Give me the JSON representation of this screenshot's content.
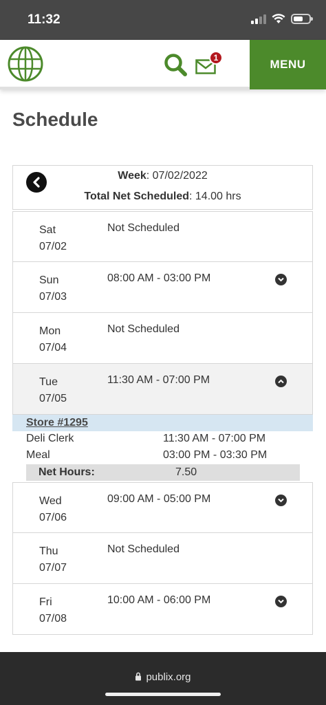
{
  "status_bar": {
    "time": "11:32"
  },
  "header": {
    "mail_badge": "1",
    "menu_label": "MENU"
  },
  "page": {
    "title": "Schedule"
  },
  "week": {
    "week_label": "Week",
    "week_value": ": 07/02/2022",
    "total_label": "Total Net Scheduled",
    "total_value": ": 14.00 hrs"
  },
  "days": [
    {
      "dow": "Sat",
      "date": "07/02",
      "shift": "Not Scheduled"
    },
    {
      "dow": "Sun",
      "date": "07/03",
      "shift": "08:00 AM - 03:00 PM"
    },
    {
      "dow": "Mon",
      "date": "07/04",
      "shift": "Not Scheduled"
    },
    {
      "dow": "Tue",
      "date": "07/05",
      "shift": "11:30 AM - 07:00 PM"
    },
    {
      "dow": "Wed",
      "date": "07/06",
      "shift": "09:00 AM - 05:00 PM"
    },
    {
      "dow": "Thu",
      "date": "07/07",
      "shift": "Not Scheduled"
    },
    {
      "dow": "Fri",
      "date": "07/08",
      "shift": "10:00 AM - 06:00 PM"
    }
  ],
  "detail": {
    "store": "Store #1295",
    "lines": [
      {
        "label": "Deli Clerk",
        "time": "11:30 AM - 07:00 PM"
      },
      {
        "label": "Meal",
        "time": "03:00 PM - 03:30 PM"
      }
    ],
    "net_hours_label": "Net Hours:",
    "net_hours_value": "7.50"
  },
  "browser": {
    "url": "publix.org"
  },
  "colors": {
    "brand_green": "#4c8a2b",
    "badge_red": "#b3181e",
    "store_bg": "#d6e6f2"
  },
  "icons": {
    "logo": "globe-logo-icon",
    "search": "search-icon",
    "mail": "mail-icon",
    "prev": "chevron-left-icon",
    "expand": "chevron-down-icon",
    "collapse": "chevron-up-icon",
    "lock": "lock-icon"
  }
}
